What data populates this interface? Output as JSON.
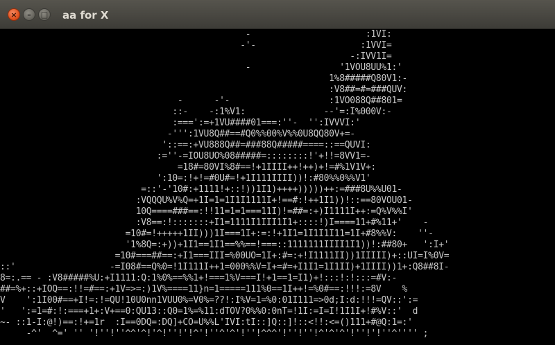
{
  "window": {
    "title": "aa for X",
    "controls": {
      "close_glyph": "×",
      "minimize_glyph": "–",
      "maximize_glyph": "□"
    }
  },
  "terminal": {
    "lines": [
      "                                               -                      :1VI:",
      "                                              -'-                    :1VVI=",
      "                                                                   -:IVV1I=",
      "                                               -                 '1VOU8UU%1:'",
      "                                                               1%8#####Q80V1:-",
      "                                                               :V8##=#=###QUV:",
      "                                  -      -'-                   :1VO088Q##801=",
      "                                 ::-    -:1%V1:               --'=:I%000V:-",
      "                                 :===':=+1VU####01===:''-  '':IVVVI:'",
      "                                -''':1VU8Q##==#Q0%%00%V%%0U8QQ80V+=-",
      "                               '::==:+VU888Q##=###88Q#####====::==QUVI:",
      "                              :=''-=IOU8UO%08#####=::::::::!'+!!=8VV1=-",
      "                                  =18#=80VI%8#==!+1IIII++!++)+!=#%1V1V+:",
      "                              ':10=:!+!=#0U#=!+1I111IIII))!:#80%%0%%V1'",
      "                           =::'-'10#:+1111!+::!))1I1)++++)))))++:=###8U%%U01-",
      "                          :VQQQU%V%Q=+1I=1=1I1I1111I+!==#:!++1I1))!::==80VOU01-",
      "                          10Q====###==:!!11=1=1===11I)!=##=:+)I1111I++:=Q%V%%I'",
      "                          :V8==:!:::::::+I1=1111I1III1I1+::::!)I====11+#%11+'    -",
      "                        =10#=!+++++1II)))1I===1I+:=:!+1I1=1I1I1I11=1I+#8%%V:    ''-",
      "                        '1%8Q=:+))+1I1==1I1==%%==!===::1111111IIII1I1))!:##80+   ':I+'",
      "                      =10#===##==:+I1===III=%00UO=1I+:#=:+!I1111II))1IIIII)+::UI=I%0V=",
      "::'                  -=I08#==Q%0=!1I111I++1=000%%V=I+=#=+I1I1=1I1II)+1IIII))1+:Q8##8I-",
      "8=:.== - :V8#####%U:+I1111:Q:1%0%==%%1+!===1%V===I!+1==1=I1)+!:::!:!:::=#V:-",
      "##=%+::+IOQ==:!!=#==:+1V=>=:)1V%====11}n=1=====111%0==1I++!=%0#==:!!!:=8V    %",
      "V    ':1I00#==+I!=:!=QU!10U0nn1VUU0%=V0%=??!:I%V=1=%0:01I111=>0d;I:d:!!!=QV::':=",
      "'   ':=1=#:!:===+1+:V+==0:QU13::Q0=1%=%11:dTOV?0%%0:0nT=!1I:=I=I!1I1I+!#%V::'  d",
      "~- ::1-I:@!)==:!+=1r  :I==0DQ=:DQ]+CO=U%%L'IVI:tI::]Q::]!::<!!:<=()111+#@Q:1=:'",
      "     -^'  ^=' '' '!''!''^^'^!'^!''!'!^'!''^'^'!''!^^^'!''!''!^'^'^'!''!'!''^'''' ;"
    ]
  }
}
